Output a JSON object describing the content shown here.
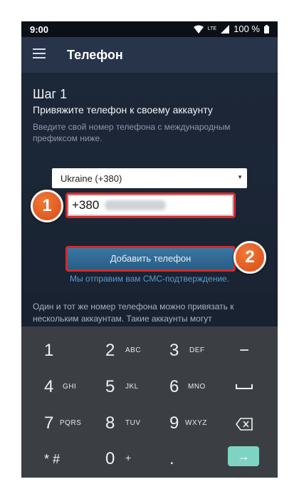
{
  "status_bar": {
    "time": "9:00",
    "network": "LTE",
    "battery": "100 %"
  },
  "app_bar": {
    "title": "Телефон",
    "menu_icon": "hamburger-menu-icon"
  },
  "step": {
    "label": "Шаг 1",
    "subtitle": "Привяжите телефон к своему аккаунту",
    "hint": "Введите свой номер телефона с международным префиксом ниже."
  },
  "country_select": {
    "value": "Ukraine (+380)"
  },
  "phone_input": {
    "value": "+380"
  },
  "add_button": {
    "label": "Добавить телефон"
  },
  "sms_note": "Мы отправим вам СМС-подтверждение.",
  "info_text": "Один и тот же номер телефона можно привязать к нескольким аккаунтам. Такие аккаунты могут",
  "markers": [
    "1",
    "2"
  ],
  "colors": {
    "highlight_border": "#d62a2a",
    "marker_fill": "#e0561c",
    "accent_link": "#5b9bd1",
    "go_key": "#7fd3c3"
  },
  "keyboard": {
    "keys": [
      {
        "digit": "1",
        "letters": ""
      },
      {
        "digit": "2",
        "letters": "ABC"
      },
      {
        "digit": "3",
        "letters": "DEF"
      },
      {
        "digit": "−",
        "letters": ""
      },
      {
        "digit": "4",
        "letters": "GHI"
      },
      {
        "digit": "5",
        "letters": "JKL"
      },
      {
        "digit": "6",
        "letters": "MNO"
      },
      {
        "digit": "␣",
        "letters": ""
      },
      {
        "digit": "7",
        "letters": "PQRS"
      },
      {
        "digit": "8",
        "letters": "TUV"
      },
      {
        "digit": "9",
        "letters": "WXYZ"
      },
      {
        "digit": "⌫",
        "letters": ""
      },
      {
        "digit": "* #",
        "letters": ""
      },
      {
        "digit": "0",
        "letters": "+"
      },
      {
        "digit": ".",
        "letters": ""
      },
      {
        "digit": "→",
        "letters": ""
      }
    ]
  }
}
